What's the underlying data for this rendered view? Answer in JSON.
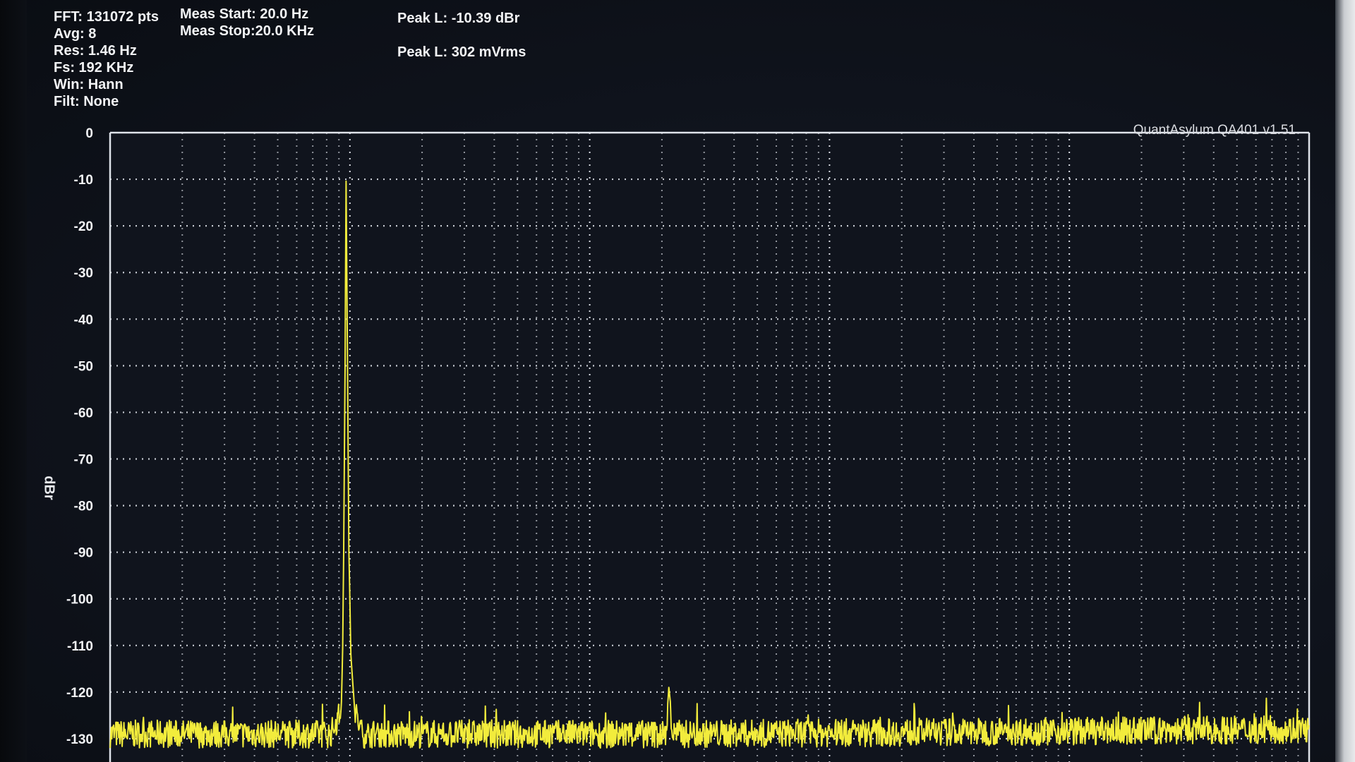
{
  "info": {
    "col1": [
      "FFT: 131072 pts",
      "Avg: 8",
      "Res: 1.46 Hz",
      "Fs: 192 KHz",
      "Win: Hann",
      "Filt: None"
    ],
    "col2": [
      "Meas Start: 20.0 Hz",
      "Meas Stop:20.0 KHz"
    ],
    "col3": [
      "Peak L: -10.39 dBr",
      "Peak L: 302 mVrms"
    ]
  },
  "watermark": "QuantAsylum QA401 v1.51",
  "colors": {
    "trace": "#f2ec3c",
    "grid": "#e8ebf2",
    "frame": "#dfe3ea",
    "background": "#10141d"
  },
  "chart_data": {
    "type": "line",
    "title": "",
    "xlabel": "",
    "ylabel": "dBr",
    "ylim": [
      -135,
      0
    ],
    "yticks": [
      0,
      -10,
      -20,
      -30,
      -40,
      -50,
      -60,
      -70,
      -80,
      -90,
      -100,
      -110,
      -120,
      -130
    ],
    "xlim": [
      0,
      2500
    ],
    "xticks_labeled": false,
    "grid": true,
    "series": [
      {
        "x": [
          0,
          460,
          482,
          485,
          487,
          490,
          492,
          495,
          498,
          502,
          510,
          525,
          1160,
          1163,
          1165,
          1168,
          1171,
          2500
        ],
        "y": [
          -129,
          -129,
          -124,
          -110,
          -90,
          -50,
          -10.39,
          -50,
          -90,
          -112,
          -124,
          -129,
          -129,
          -122,
          -119,
          -122,
          -129,
          -128
        ]
      }
    ]
  }
}
